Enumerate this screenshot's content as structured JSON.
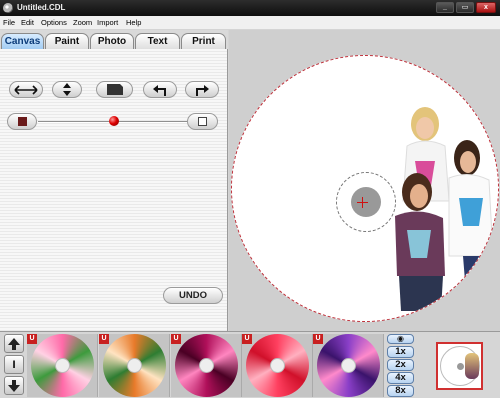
{
  "window": {
    "title": "Untitled.CDL",
    "min_label": "_",
    "max_label": "▭",
    "close_label": "x"
  },
  "menu": [
    "File",
    "Edit",
    "Options",
    "Zoom",
    "Import",
    "Help"
  ],
  "tabs": [
    {
      "label": "Canvas",
      "active": true
    },
    {
      "label": "Paint",
      "active": false
    },
    {
      "label": "Photo",
      "active": false
    },
    {
      "label": "Text",
      "active": false
    },
    {
      "label": "Print",
      "active": false
    }
  ],
  "toolbar": {
    "icons": [
      "flip-horizontal-icon",
      "flip-vertical-icon",
      "fill-shape-icon",
      "rotate-left-icon",
      "rotate-right-icon"
    ],
    "undo_label": "UNDO"
  },
  "opacity_slider": {
    "value_fraction": 0.5,
    "min_icon": "dark-square-icon",
    "max_icon": "light-square-icon",
    "knob_color": "#d00000"
  },
  "canvas": {
    "disc_border_color": "#c0303a",
    "crosshair_color": "#d01010"
  },
  "bottom": {
    "badge_label": "U",
    "scroll_mid_label": "I",
    "designs": [
      {
        "name": "pink-green-swirl",
        "colors": [
          "#ff6aa8",
          "#3d9b3d",
          "#ffd1e4"
        ]
      },
      {
        "name": "orange-green-swirl",
        "colors": [
          "#e87a2a",
          "#2e7d32",
          "#ffe3c1"
        ]
      },
      {
        "name": "magenta-spiral",
        "colors": [
          "#b0105a",
          "#ff86c0",
          "#4a0024"
        ]
      },
      {
        "name": "red-kaleidoscope",
        "colors": [
          "#ff4060",
          "#ffb0c0",
          "#d0102a"
        ]
      },
      {
        "name": "purple-fractal",
        "colors": [
          "#8a3fc8",
          "#ff8acb",
          "#3a136b"
        ]
      }
    ],
    "zoom_options": [
      "1x",
      "2x",
      "4x",
      "8x"
    ],
    "zoom_disc_label": "◉"
  }
}
